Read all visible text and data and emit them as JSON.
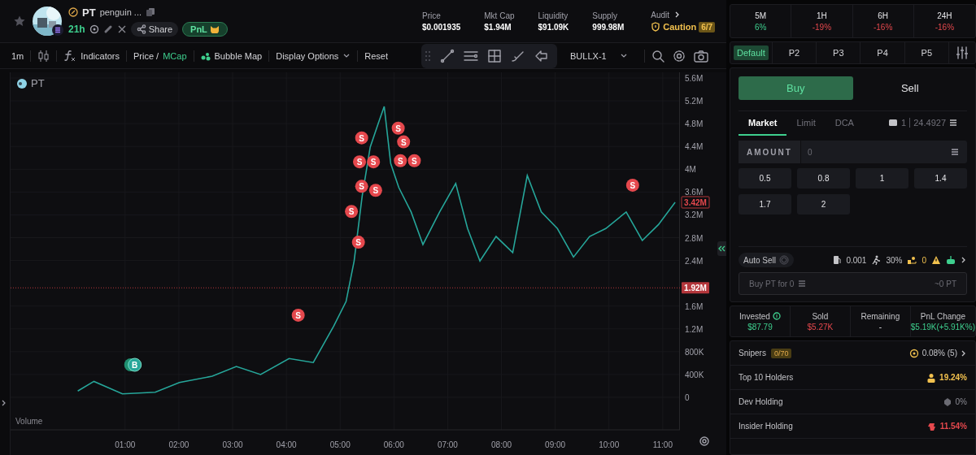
{
  "token": {
    "symbol": "PT",
    "name": "penguin ...",
    "age": "21h",
    "share": "Share",
    "pnl": "PnL"
  },
  "stats": [
    {
      "label": "Price",
      "value": "$0.001935"
    },
    {
      "label": "Mkt Cap",
      "value": "$1.94M"
    },
    {
      "label": "Liquidity",
      "value": "$91.09K"
    },
    {
      "label": "Supply",
      "value": "999.98M"
    }
  ],
  "audit": {
    "label": "Audit",
    "status": "Caution",
    "score": "6/7"
  },
  "toolbar": {
    "interval": "1m",
    "indicators": "Indicators",
    "price": "Price",
    "separator": "/",
    "mcap": "MCap",
    "bubble_map": "Bubble Map",
    "display_options": "Display Options",
    "reset": "Reset",
    "layout": "BULLX-1"
  },
  "chart": {
    "volume_label": "Volume",
    "last_price_tag": "3.42M",
    "buy_marker": "B",
    "chart_data": {
      "type": "line",
      "grid": true,
      "xlim": [
        -1.13,
        11.32
      ],
      "ylim": [
        -570000,
        5700000
      ],
      "xticks": [
        {
          "value": 1,
          "label": "01:00"
        },
        {
          "value": 2,
          "label": "02:00"
        },
        {
          "value": 3,
          "label": "03:00"
        },
        {
          "value": 4,
          "label": "04:00"
        },
        {
          "value": 5,
          "label": "05:00"
        },
        {
          "value": 6,
          "label": "06:00"
        },
        {
          "value": 7,
          "label": "07:00"
        },
        {
          "value": 8,
          "label": "08:00"
        },
        {
          "value": 9,
          "label": "09:00"
        },
        {
          "value": 10,
          "label": "10:00"
        },
        {
          "value": 11,
          "label": "11:00"
        }
      ],
      "yticks": [
        {
          "value": 0,
          "label": "0"
        },
        {
          "value": 400000,
          "label": "400K"
        },
        {
          "value": 800000,
          "label": "800K"
        },
        {
          "value": 1200000,
          "label": "1.2M"
        },
        {
          "value": 1600000,
          "label": "1.6M"
        },
        {
          "value": 2400000,
          "label": "2.4M"
        },
        {
          "value": 2800000,
          "label": "2.8M"
        },
        {
          "value": 3200000,
          "label": "3.2M"
        },
        {
          "value": 3600000,
          "label": "3.6M"
        },
        {
          "value": 4000000,
          "label": "4M"
        },
        {
          "value": 4400000,
          "label": "4.4M"
        },
        {
          "value": 4800000,
          "label": "4.8M"
        },
        {
          "value": 5200000,
          "label": "5.2M"
        },
        {
          "value": 5600000,
          "label": "5.6M"
        }
      ],
      "x": [
        0.12,
        0.42,
        0.95,
        1.56,
        2.01,
        2.62,
        3.07,
        3.52,
        4.05,
        4.5,
        4.88,
        5.11,
        5.26,
        5.41,
        5.56,
        5.71,
        5.82,
        5.94,
        6.09,
        6.32,
        6.54,
        6.85,
        7.15,
        7.37,
        7.6,
        7.9,
        8.21,
        8.48,
        8.74,
        9.04,
        9.34,
        9.64,
        9.94,
        10.32,
        10.62,
        10.92,
        11.23
      ],
      "series": [
        {
          "name": "PT",
          "color": "#26a69a",
          "values": [
            110000,
            280000,
            60000,
            90000,
            260000,
            370000,
            540000,
            400000,
            680000,
            610000,
            1250000,
            1680000,
            2390000,
            3530000,
            4390000,
            4810000,
            5100000,
            4100000,
            3680000,
            3250000,
            2680000,
            3250000,
            3750000,
            2960000,
            2390000,
            2820000,
            2540000,
            3890000,
            3250000,
            2960000,
            2460000,
            2820000,
            2960000,
            3250000,
            2750000,
            3030000,
            3420000
          ]
        }
      ],
      "ref_lines": [
        {
          "axis": "y",
          "value": 1920000,
          "label": "1.92M"
        }
      ],
      "annotations": [
        {
          "x": 5.4,
          "y": 4550000,
          "text": "S"
        },
        {
          "x": 6.08,
          "y": 4720000,
          "text": "S"
        },
        {
          "x": 6.18,
          "y": 4480000,
          "text": "S"
        },
        {
          "x": 5.36,
          "y": 4130000,
          "text": "S"
        },
        {
          "x": 5.62,
          "y": 4130000,
          "text": "S"
        },
        {
          "x": 6.12,
          "y": 4150000,
          "text": "S"
        },
        {
          "x": 6.38,
          "y": 4150000,
          "text": "S"
        },
        {
          "x": 5.4,
          "y": 3700000,
          "text": "S"
        },
        {
          "x": 5.66,
          "y": 3630000,
          "text": "S"
        },
        {
          "x": 5.21,
          "y": 3260000,
          "text": "S"
        },
        {
          "x": 5.34,
          "y": 2720000,
          "text": "S"
        },
        {
          "x": 4.22,
          "y": 1440000,
          "text": "S"
        },
        {
          "x": 10.44,
          "y": 3720000,
          "text": "S"
        }
      ]
    }
  },
  "timeframes": [
    {
      "label": "5M",
      "change": "6%",
      "kind": "gain"
    },
    {
      "label": "1H",
      "change": "-19%",
      "kind": "loss"
    },
    {
      "label": "6H",
      "change": "-16%",
      "kind": "loss"
    },
    {
      "label": "24H",
      "change": "-16%",
      "kind": "loss"
    }
  ],
  "presets": [
    {
      "label": "Default",
      "selected": true
    },
    {
      "label": "P2",
      "selected": false
    },
    {
      "label": "P3",
      "selected": false
    },
    {
      "label": "P4",
      "selected": false
    },
    {
      "label": "P5",
      "selected": false
    }
  ],
  "trade": {
    "sides": [
      {
        "label": "Buy",
        "selected": true
      },
      {
        "label": "Sell",
        "selected": false
      }
    ],
    "order_types": [
      {
        "label": "Market",
        "selected": true
      },
      {
        "label": "Limit",
        "selected": false
      },
      {
        "label": "DCA",
        "selected": false
      }
    ],
    "wallet": {
      "count": "1",
      "balance": "24.4927"
    },
    "amount": {
      "label": "AMOUNT",
      "placeholder": "0"
    },
    "quick_amounts": [
      "0.5",
      "0.8",
      "1",
      "1.4",
      "1.7",
      "2"
    ],
    "auto_sell": {
      "label": "Auto Sell",
      "on": false
    },
    "fee": "0.001",
    "slippage": "30%",
    "tip": "0",
    "submit": {
      "label": "Buy PT for 0",
      "estimate": "~0 PT",
      "disabled": true
    }
  },
  "position": [
    {
      "label": "Invested",
      "value": "$87.79",
      "kind": "gain"
    },
    {
      "label": "Sold",
      "value": "$5.27K",
      "kind": "loss"
    },
    {
      "label": "Remaining",
      "value": "-",
      "kind": "neutral"
    },
    {
      "label": "PnL Change",
      "value": "$5.19K(+5.91K%)",
      "kind": "gain"
    }
  ],
  "holders": [
    {
      "label": "Snipers",
      "badge": "0/70",
      "value": "0.08% (5)",
      "kind": "snipers"
    },
    {
      "label": "Top 10 Holders",
      "value": "19.24%",
      "kind": "top"
    },
    {
      "label": "Dev Holding",
      "value": "0%",
      "kind": "dev"
    },
    {
      "label": "Insider Holding",
      "value": "11.54%",
      "kind": "insider"
    }
  ]
}
